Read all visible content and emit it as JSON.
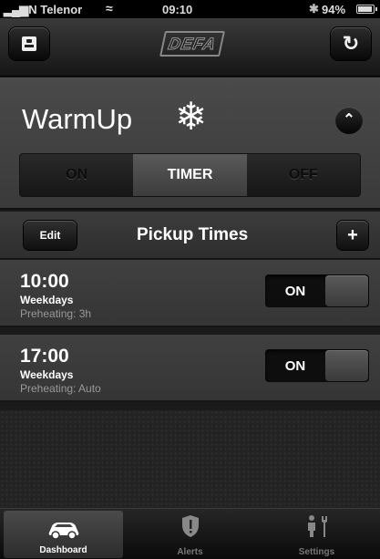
{
  "status_bar": {
    "signal": "▂▄▆",
    "carrier": "N Telenor",
    "time": "09:10",
    "battery": "94%",
    "battery_level": 0.94
  },
  "nav": {
    "logo": "DEFA",
    "profile_icon": "profile-icon",
    "refresh_icon": "refresh-icon"
  },
  "warmup": {
    "title": "WarmUp",
    "icon": "snowflake-icon",
    "modes": [
      "ON",
      "TIMER",
      "OFF"
    ],
    "selected_mode": "TIMER"
  },
  "pickup": {
    "edit_label": "Edit",
    "title": "Pickup Times",
    "add_label": "+",
    "items": [
      {
        "time": "10:00",
        "days": "Weekdays",
        "preheat": "Preheating: 3h",
        "state": "ON"
      },
      {
        "time": "17:00",
        "days": "Weekdays",
        "preheat": "Preheating: Auto",
        "state": "ON"
      }
    ]
  },
  "tabs": [
    {
      "label": "Dashboard",
      "icon": "car-icon",
      "active": true
    },
    {
      "label": "Alerts",
      "icon": "alert-icon",
      "active": false
    },
    {
      "label": "Settings",
      "icon": "settings-icon",
      "active": false
    }
  ],
  "colors": {
    "background": "#1a1a1a",
    "panel": "#404040",
    "text": "#ffffff",
    "muted": "#999999"
  }
}
